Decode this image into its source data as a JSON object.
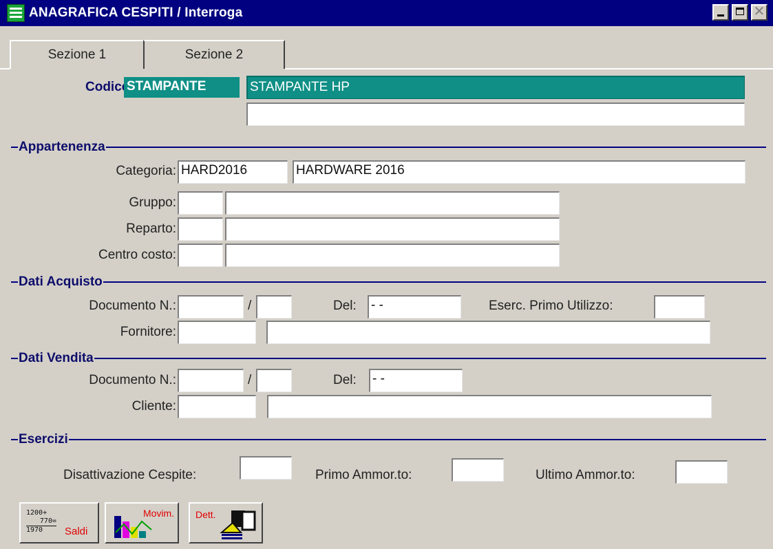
{
  "window": {
    "title": "ANAGRAFICA CESPITI / Interroga",
    "close_symbol": "✕"
  },
  "tabs": [
    "Sezione 1",
    "Sezione 2"
  ],
  "header": {
    "codice_label": "Codice:",
    "codice_value": "STAMPANTE",
    "description": "STAMPANTE HP",
    "description2": ""
  },
  "appartenenza": {
    "title": "Appartenenza",
    "categoria_label": "Categoria:",
    "categoria_code": "HARD2016",
    "categoria_desc": "HARDWARE 2016",
    "gruppo_label": "Gruppo:",
    "reparto_label": "Reparto:",
    "centro_costo_label": "Centro costo:"
  },
  "dati_acquisto": {
    "title": "Dati Acquisto",
    "documento_label": "Documento N.:",
    "slash": "/",
    "del_label": "Del:",
    "del_value": " - -",
    "esercizio_label": "Eserc. Primo Utilizzo:",
    "fornitore_label": "Fornitore:"
  },
  "dati_vendita": {
    "title": "Dati Vendita",
    "documento_label": "Documento N.:",
    "slash": "/",
    "del_label": "Del:",
    "del_value": " - -",
    "cliente_label": "Cliente:"
  },
  "esercizi": {
    "title": "Esercizi",
    "disattivazione_label": "Disattivazione Cespite:",
    "primo_label": "Primo Ammor.to:",
    "ultimo_label": "Ultimo Ammor.to:"
  },
  "toolbar": {
    "saldi_label": "Saldi",
    "saldi_numbers": [
      "1200+",
      "770=",
      "1970"
    ],
    "movim_label": "Movim.",
    "dett_label": "Dett."
  },
  "colors": {
    "titlebar": "#000080",
    "teal": "#0f8f86",
    "section": "#000080",
    "red": "#e00000"
  }
}
